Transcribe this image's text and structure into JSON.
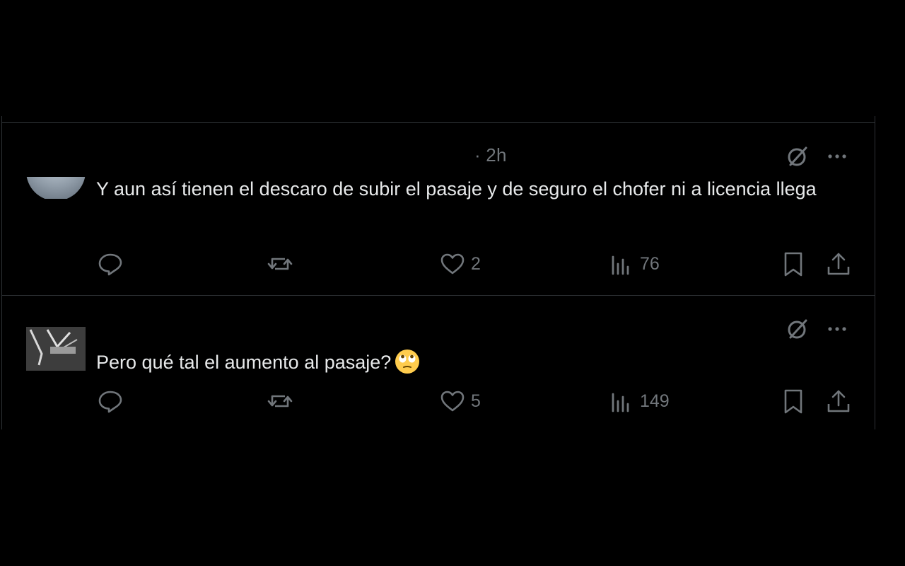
{
  "colors": {
    "background": "#000000",
    "border": "#2f3336",
    "text_primary": "#e7e9ea",
    "text_secondary": "#71767b"
  },
  "posts": [
    {
      "timestamp": "· 2h",
      "text": "Y aun así tienen el descaro de subir el pasaje y de seguro el chofer ni a licencia llega",
      "actions": {
        "reply_icon": "reply-icon",
        "repost_icon": "repost-icon",
        "like_icon": "heart-icon",
        "likes": "2",
        "views_icon": "views-icon",
        "views": "76",
        "bookmark_icon": "bookmark-icon",
        "share_icon": "share-icon"
      }
    },
    {
      "text": "Pero qué tal el aumento al pasaje?",
      "emoji": "face-with-rolling-eyes",
      "actions": {
        "reply_icon": "reply-icon",
        "repost_icon": "repost-icon",
        "like_icon": "heart-icon",
        "likes": "5",
        "views_icon": "views-icon",
        "views": "149",
        "bookmark_icon": "bookmark-icon",
        "share_icon": "share-icon"
      }
    }
  ]
}
